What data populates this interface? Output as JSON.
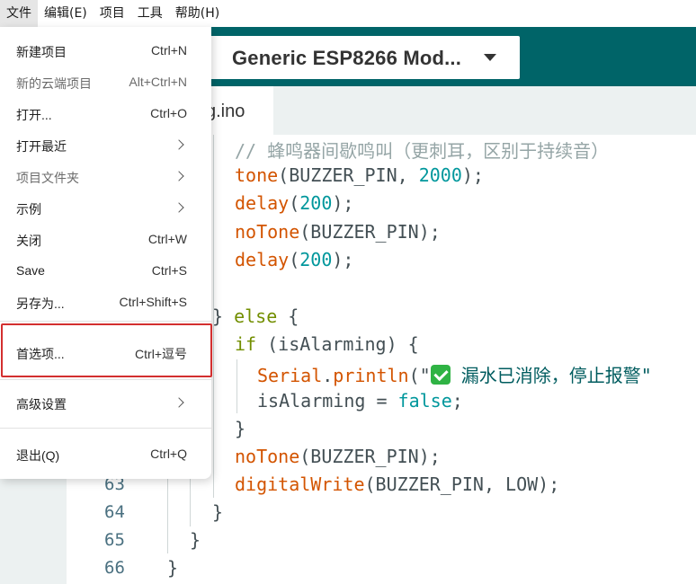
{
  "menubar": {
    "items": [
      "文件",
      "编辑(E)",
      "项目",
      "工具",
      "帮助(H)"
    ]
  },
  "toolbar": {
    "board_label": "Generic ESP8266 Mod..."
  },
  "tab": {
    "label": "g.ino"
  },
  "file_menu": {
    "items": [
      {
        "label": "新建项目",
        "shortcut": "Ctrl+N"
      },
      {
        "label": "新的云端项目",
        "shortcut": "Alt+Ctrl+N"
      },
      {
        "label": "打开...",
        "shortcut": "Ctrl+O"
      },
      {
        "label": "打开最近",
        "shortcut": ""
      },
      {
        "label": "项目文件夹",
        "shortcut": ""
      },
      {
        "label": "示例",
        "shortcut": ""
      },
      {
        "label": "关闭",
        "shortcut": "Ctrl+W"
      },
      {
        "label": "Save",
        "shortcut": "Ctrl+S"
      },
      {
        "label": "另存为...",
        "shortcut": "Ctrl+Shift+S"
      },
      {
        "label": "首选项...",
        "shortcut": "Ctrl+逗号"
      },
      {
        "label": "高级设置",
        "shortcut": ""
      },
      {
        "label": "退出(Q)",
        "shortcut": "Ctrl+Q"
      }
    ]
  },
  "editor": {
    "line_numbers": [
      "63",
      "64",
      "65",
      "66"
    ],
    "code": {
      "comment": "// 蜂鸣器间歇鸣叫（更刺耳，区别于持续音）",
      "tone_fn": "tone",
      "tone_args": "(BUZZER_PIN, ",
      "tone_num": "2000",
      "tone_end": ");",
      "delay_fn": "delay",
      "delay_open": "(",
      "delay_num": "200",
      "delay_end": ");",
      "notone_fn": "noTone",
      "notone_args": "(BUZZER_PIN);",
      "else_open": "} ",
      "else_kw": "else",
      "else_brace": " {",
      "if_kw": "if",
      "if_cond": " (isAlarming) {",
      "serial_cls": "Serial",
      "dot": ".",
      "println_fn": "println",
      "println_open": "(\"",
      "println_text": " 漏水已消除，停止报警\"",
      "is_alarming_var": "isAlarming = ",
      "false_kw": "false",
      "semi": ";",
      "close_brace": "}",
      "dw_fn": "digitalWrite",
      "dw_args": "(BUZZER_PIN, LOW);"
    }
  },
  "colors": {
    "toolbar_bg": "#006468",
    "highlight_border": "#d32f2f",
    "check_green": "#2fb344"
  }
}
